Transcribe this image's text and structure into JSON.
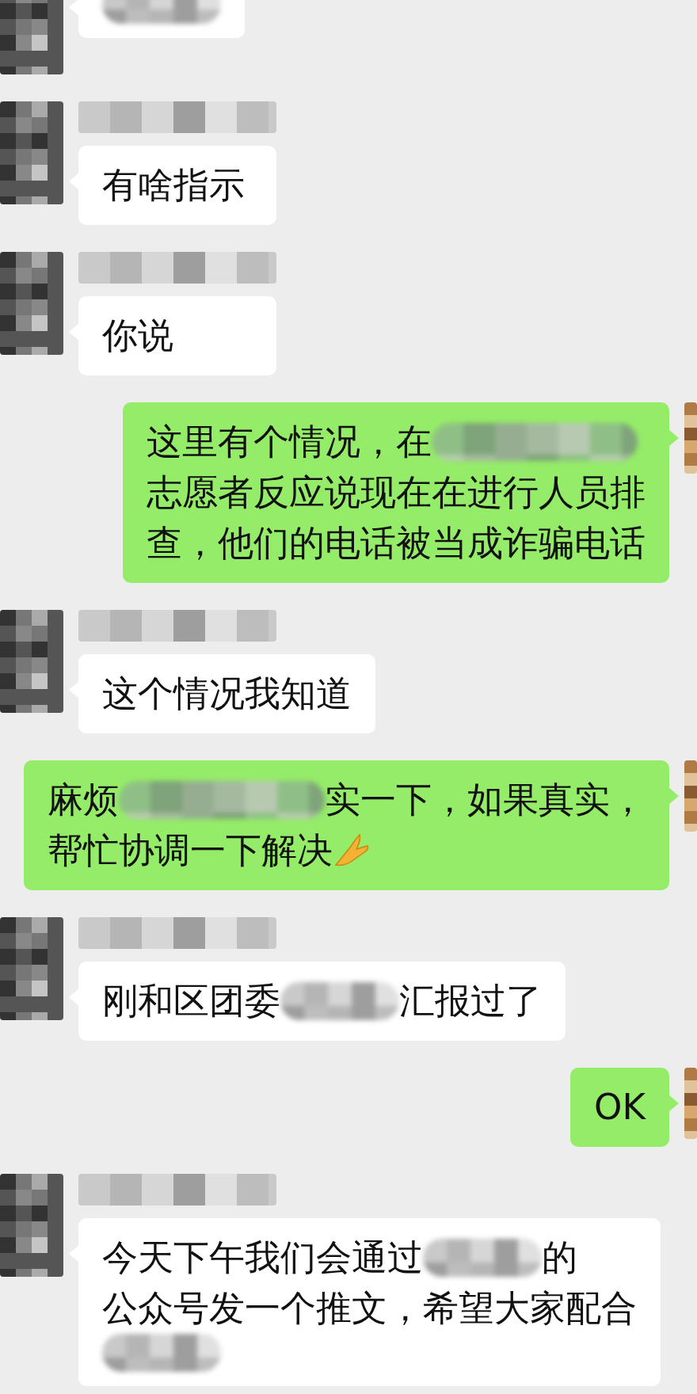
{
  "messages": [
    {
      "kind": "incoming",
      "lines": [
        [
          {
            "kind": "redaction"
          }
        ]
      ]
    },
    {
      "kind": "incoming",
      "lines": [
        [
          {
            "kind": "text",
            "text": "有啥指示"
          }
        ]
      ]
    },
    {
      "kind": "incoming",
      "lines": [
        [
          {
            "kind": "text",
            "text": "你说"
          }
        ]
      ]
    },
    {
      "kind": "outgoing",
      "lines": [
        [
          {
            "kind": "text",
            "text": "这里有个情况，在"
          },
          {
            "kind": "redaction"
          }
        ],
        [
          {
            "kind": "text",
            "text": "志愿者反应说现在在进行人员排"
          }
        ],
        [
          {
            "kind": "text",
            "text": "查，他们的电话被当成诈骗电话"
          }
        ]
      ]
    },
    {
      "kind": "incoming",
      "lines": [
        [
          {
            "kind": "text",
            "text": "这个情况我知道"
          }
        ]
      ]
    },
    {
      "kind": "outgoing",
      "lines": [
        [
          {
            "kind": "text",
            "text": "麻烦"
          },
          {
            "kind": "redaction"
          },
          {
            "kind": "text",
            "text": "实一下，如果真实，"
          }
        ],
        [
          {
            "kind": "text",
            "text": "帮忙协调一下解决"
          },
          {
            "kind": "emoji"
          }
        ]
      ]
    },
    {
      "kind": "incoming",
      "lines": [
        [
          {
            "kind": "text",
            "text": "刚和区团委"
          },
          {
            "kind": "redaction"
          },
          {
            "kind": "text",
            "text": "汇报过了"
          }
        ]
      ]
    },
    {
      "kind": "outgoing",
      "lines": [
        [
          {
            "kind": "text",
            "text": "OK"
          }
        ]
      ]
    },
    {
      "kind": "incoming",
      "lines": [
        [
          {
            "kind": "text",
            "text": "今天下午我们会通过"
          },
          {
            "kind": "redaction"
          },
          {
            "kind": "text",
            "text": "的"
          }
        ],
        [
          {
            "kind": "text",
            "text": "公众号发一个推文，希望大家配合"
          }
        ],
        [
          {
            "kind": "redaction"
          }
        ]
      ]
    }
  ]
}
